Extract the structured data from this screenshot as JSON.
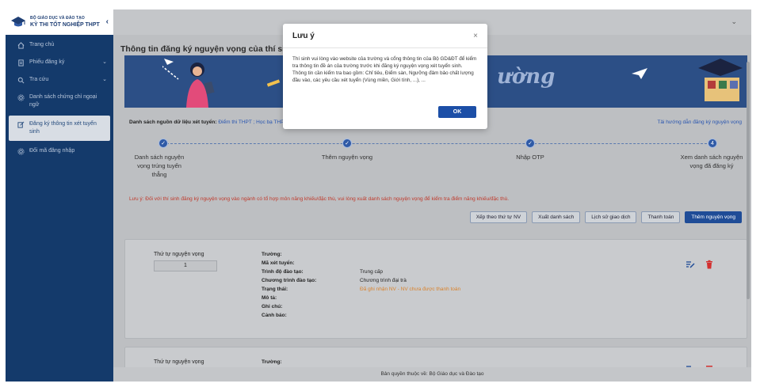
{
  "brand": {
    "subtitle": "BỘ GIÁO DỤC VÀ ĐÀO TẠO",
    "title": "KỲ THI TỐT NGHIỆP THPT",
    "collapse_glyph": "‹"
  },
  "sidebar": {
    "items": [
      {
        "label": "Trang chủ",
        "icon": "home-icon",
        "arrow": ""
      },
      {
        "label": "Phiếu đăng ký",
        "icon": "document-icon",
        "arrow": "⌄"
      },
      {
        "label": "Tra cứu",
        "icon": "search-icon",
        "arrow": "⌄"
      },
      {
        "label": "Danh sách chứng chỉ ngoại ngữ",
        "icon": "gear-icon",
        "arrow": ""
      },
      {
        "label": "Đăng ký thông tin xét tuyển sinh",
        "icon": "edit-icon",
        "arrow": ""
      },
      {
        "label": "Đổi mã đăng nhập",
        "icon": "gear-icon",
        "arrow": ""
      }
    ],
    "active_index": 4
  },
  "header": {
    "chevron": "⌄"
  },
  "page": {
    "title": "Thông tin đăng ký nguyện vọng của thí sinh",
    "banner_text": "ường"
  },
  "source": {
    "label": "Danh sách nguồn dữ liệu xét tuyển:",
    "value": "Điểm thi THPT ; Học bạ THPT; Điểm ĐGNL/Tư duy/...; Khác",
    "guide_link": "Tải hướng dẫn đăng ký nguyện vọng"
  },
  "stepper": {
    "steps": [
      {
        "label": "Danh sách nguyện vọng trúng tuyển thẳng",
        "marker": "✓"
      },
      {
        "label": "Thêm nguyện vọng",
        "marker": "✓"
      },
      {
        "label": "Nhập OTP",
        "marker": "✓"
      },
      {
        "label": "Xem danh sách nguyện vọng đã đăng ký",
        "marker": "4"
      }
    ]
  },
  "warning": "Lưu ý: Đối với thí sinh đăng ký nguyện vọng vào ngành có tổ hợp môn năng khiếu/đặc thù, vui lòng xuất danh sách nguyện vọng để kiểm tra điểm năng khiếu/đặc thù.",
  "actions": {
    "sort": "Xếp theo thứ tự NV",
    "export": "Xuất danh sách",
    "history": "Lịch sử giao dịch",
    "payment": "Thanh toán",
    "add": "Thêm nguyện vọng"
  },
  "cards": [
    {
      "order_label": "Thứ tự nguyện vọng",
      "order_value": "1",
      "fields": [
        {
          "key": "Trường:",
          "value": ""
        },
        {
          "key": "Mã xét tuyển:",
          "value": ""
        },
        {
          "key": "Trình độ đào tạo:",
          "value": "Trung cấp"
        },
        {
          "key": "Chương trình đào tạo:",
          "value": "Chương trình đại trà"
        },
        {
          "key": "Trạng thái:",
          "value": "Đã ghi nhận NV - NV chưa được thanh toán"
        },
        {
          "key": "Mô tả:",
          "value": ""
        },
        {
          "key": "Ghi chú:",
          "value": ""
        },
        {
          "key": "Cảnh báo:",
          "value": ""
        }
      ]
    },
    {
      "order_label": "Thứ tự nguyện vọng",
      "fields": [
        {
          "key": "Trường:",
          "value": ""
        }
      ]
    }
  ],
  "footer": "Bản quyền thuộc về: Bộ Giáo dục và Đào tạo",
  "modal": {
    "title": "Lưu ý",
    "close": "×",
    "paragraph1": "Thí sinh vui lòng vào website của trường và cổng thông tin của Bộ GD&ĐT để kiểm tra thông tin đề án của trường trước khi đăng ký nguyện vọng xét tuyển sinh.",
    "paragraph2": "Thông tin cần kiểm tra bao gồm: Chỉ tiêu, Điểm sàn, Ngưỡng đảm bảo chất lượng đầu vào, các yêu cầu xét tuyển (Vùng miền, Giới tính, ...), ...",
    "ok": "OK"
  },
  "colors": {
    "sidebar_bg": "#143a6b",
    "primary": "#1f4c97",
    "warning_text": "#c0392b",
    "status_text": "#d9822b",
    "delete_icon": "#d32f2f"
  }
}
